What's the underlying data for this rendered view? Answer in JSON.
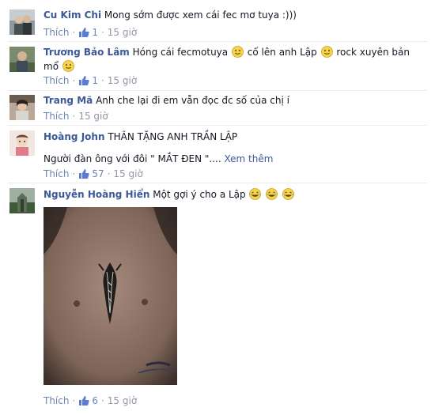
{
  "comments": [
    {
      "author": "Cu Kim Chi",
      "text": "Mong sớm được xem cái fec mơ tuya :)))",
      "like_label": "Thích",
      "like_count": "1",
      "time": "15 giờ"
    },
    {
      "author": "Trương Bảo Lâm",
      "text_part1": "Hóng cái fecmotuya",
      "text_part2": "cố lên anh Lập",
      "text_part3": "rock xuyên bản",
      "text_line2": "mổ",
      "like_label": "Thích",
      "like_count": "1",
      "time": "15 giờ"
    },
    {
      "author": "Trang Mã",
      "text": "Anh che lại đi em vẫn đọc đc số của chị í",
      "like_label": "Thích",
      "time": "15 giờ"
    },
    {
      "author": "Hoàng John",
      "text": "THÂN TẶNG ANH TRẦN LẬP",
      "text_line2": "Người đàn ông với đôi \" MẮT ĐEN \"....",
      "see_more": "Xem thêm",
      "like_label": "Thích",
      "like_count": "57",
      "time": "15 giờ"
    },
    {
      "author": "Nguyễn Hoàng Hiển",
      "text": "Một gợi ý cho a Lập",
      "like_label": "Thích",
      "like_count": "6",
      "time": "15 giờ"
    }
  ],
  "icons": {
    "like": "thumbs-up-icon",
    "emoji_smile": "smile-emoji",
    "emoji_laugh": "laugh-emoji"
  },
  "colors": {
    "author": "#3b5998",
    "meta": "#9197a3",
    "link": "#6d84b4"
  }
}
